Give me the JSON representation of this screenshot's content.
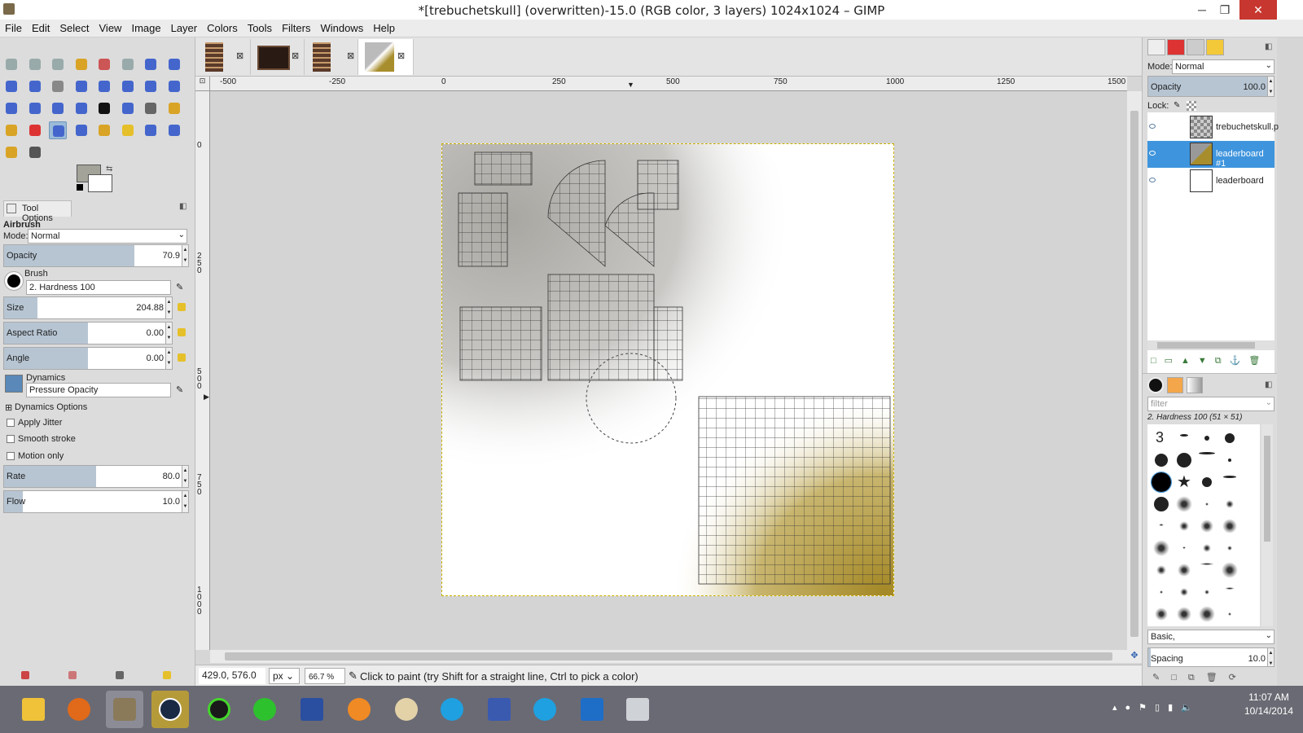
{
  "window": {
    "title": "*[trebuchetskull] (overwritten)-15.0 (RGB color, 3 layers) 1024x1024 – GIMP",
    "minimize": "─",
    "maximize": "❐",
    "close": "✕"
  },
  "menu": [
    "File",
    "Edit",
    "Select",
    "View",
    "Image",
    "Layer",
    "Colors",
    "Tools",
    "Filters",
    "Windows",
    "Help"
  ],
  "tool_options": {
    "tab_label": "Tool Options",
    "tool_name": "Airbrush",
    "mode_label": "Mode:",
    "mode_value": "Normal",
    "opacity": {
      "label": "Opacity",
      "value": "70.9",
      "fraction": 0.709
    },
    "brush_label": "Brush",
    "brush_value": "2. Hardness 100",
    "size": {
      "label": "Size",
      "value": "204.88",
      "fraction": 0.2
    },
    "aspect_ratio": {
      "label": "Aspect Ratio",
      "value": "0.00",
      "fraction": 0.5
    },
    "angle": {
      "label": "Angle",
      "value": "0.00",
      "fraction": 0.5
    },
    "dynamics_label": "Dynamics",
    "dynamics_value": "Pressure Opacity",
    "dynamics_options": "Dynamics Options",
    "apply_jitter": "Apply Jitter",
    "smooth_stroke": "Smooth stroke",
    "motion_only": "Motion only",
    "rate": {
      "label": "Rate",
      "value": "80.0",
      "fraction": 0.5
    },
    "flow": {
      "label": "Flow",
      "value": "10.0",
      "fraction": 0.1
    }
  },
  "rulers": {
    "h": [
      "-500",
      "-250",
      "0",
      "250",
      "500",
      "750",
      "1000",
      "1250",
      "1500"
    ],
    "v": [
      "0",
      "2 5 0",
      "5 0 0",
      "7 5 0",
      "1 0 0 0"
    ]
  },
  "status": {
    "coords": "429.0, 576.0",
    "unit": "px",
    "zoom": "66.7 %",
    "message": "Click to paint (try Shift for a straight line, Ctrl to pick a color)"
  },
  "layers": {
    "mode_label": "Mode:",
    "mode_value": "Normal",
    "opacity_label": "Opacity",
    "opacity_value": "100.0",
    "lock_label": "Lock:",
    "items": [
      {
        "name": "trebuchetskull.p",
        "selected": false
      },
      {
        "name": "leaderboard #1",
        "selected": true
      },
      {
        "name": "leaderboard",
        "selected": false
      }
    ]
  },
  "brushes": {
    "filter_placeholder": "filter",
    "current": "2. Hardness 100 (51 × 51)",
    "preset": "Basic,",
    "spacing_label": "Spacing",
    "spacing_value": "10.0",
    "first_label": "3"
  },
  "clock": {
    "time": "11:07 AM",
    "date": "10/14/2014"
  },
  "colors": {
    "fg": "#a3a39a",
    "bg": "#ffffff",
    "selection": "#3f95dd",
    "taskbar": "#6a6a74",
    "mustard": "#a88d2c"
  }
}
